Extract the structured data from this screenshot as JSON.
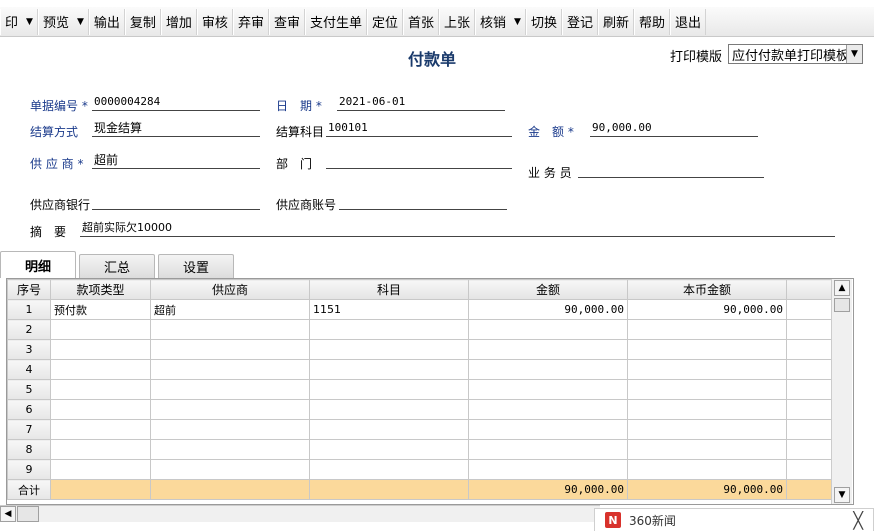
{
  "toolbar": {
    "buttons": [
      {
        "label": "印",
        "has_dropdown": true
      },
      {
        "label": "预览",
        "has_dropdown": true
      },
      {
        "label": "输出"
      },
      {
        "label": "复制"
      },
      {
        "label": "增加"
      },
      {
        "label": "审核"
      },
      {
        "label": "弃审"
      },
      {
        "label": "查审"
      },
      {
        "label": "支付生单"
      },
      {
        "label": "定位"
      },
      {
        "label": "首张"
      },
      {
        "label": "上张"
      },
      {
        "label": "核销",
        "has_dropdown": true
      },
      {
        "label": "切换"
      },
      {
        "label": "登记"
      },
      {
        "label": "刷新"
      },
      {
        "label": "帮助"
      },
      {
        "label": "退出"
      }
    ]
  },
  "form": {
    "title": "付款单",
    "print_template_label": "打印模版",
    "print_template_value": "应付付款单打印模板",
    "fields": {
      "doc_no": {
        "label": "单据编号",
        "value": "0000004284"
      },
      "date": {
        "label": "日　期",
        "value": "2021-06-01"
      },
      "settle_method": {
        "label": "结算方式",
        "value": "现金结算"
      },
      "settle_account": {
        "label": "结算科目",
        "value": "100101"
      },
      "amount": {
        "label": "金　额",
        "value": "90,000.00"
      },
      "supplier": {
        "label": "供 应 商",
        "value": "超前"
      },
      "department": {
        "label": "部　门",
        "value": ""
      },
      "salesperson": {
        "label": "业 务 员",
        "value": ""
      },
      "supplier_bank": {
        "label": "供应商银行",
        "value": ""
      },
      "supplier_account": {
        "label": "供应商账号",
        "value": ""
      },
      "summary": {
        "label": "摘　要",
        "value": "超前实际欠10000"
      }
    },
    "required_mark": "*"
  },
  "tabs": [
    {
      "label": "明细",
      "active": true
    },
    {
      "label": "汇总",
      "active": false
    },
    {
      "label": "设置",
      "active": false
    }
  ],
  "grid": {
    "headers": [
      "序号",
      "款项类型",
      "供应商",
      "科目",
      "金额",
      "本币金额"
    ],
    "rows": [
      {
        "no": "1",
        "type": "预付款",
        "supplier": "超前",
        "account": "1151",
        "amount": "90,000.00",
        "local_amount": "90,000.00"
      },
      {
        "no": "2",
        "type": "",
        "supplier": "",
        "account": "",
        "amount": "",
        "local_amount": ""
      },
      {
        "no": "3",
        "type": "",
        "supplier": "",
        "account": "",
        "amount": "",
        "local_amount": ""
      },
      {
        "no": "4",
        "type": "",
        "supplier": "",
        "account": "",
        "amount": "",
        "local_amount": ""
      },
      {
        "no": "5",
        "type": "",
        "supplier": "",
        "account": "",
        "amount": "",
        "local_amount": ""
      },
      {
        "no": "6",
        "type": "",
        "supplier": "",
        "account": "",
        "amount": "",
        "local_amount": ""
      },
      {
        "no": "7",
        "type": "",
        "supplier": "",
        "account": "",
        "amount": "",
        "local_amount": ""
      },
      {
        "no": "8",
        "type": "",
        "supplier": "",
        "account": "",
        "amount": "",
        "local_amount": ""
      },
      {
        "no": "9",
        "type": "",
        "supplier": "",
        "account": "",
        "amount": "",
        "local_amount": ""
      }
    ],
    "total": {
      "label": "合计",
      "amount": "90,000.00",
      "local_amount": "90,000.00"
    }
  },
  "notification": {
    "logo_letter": "N",
    "title": "360新闻",
    "close_symbol": "╳"
  },
  "colors": {
    "label_blue": "#1a3a8b",
    "title_blue": "#1a3a6b",
    "total_row": "#fbd99b"
  }
}
